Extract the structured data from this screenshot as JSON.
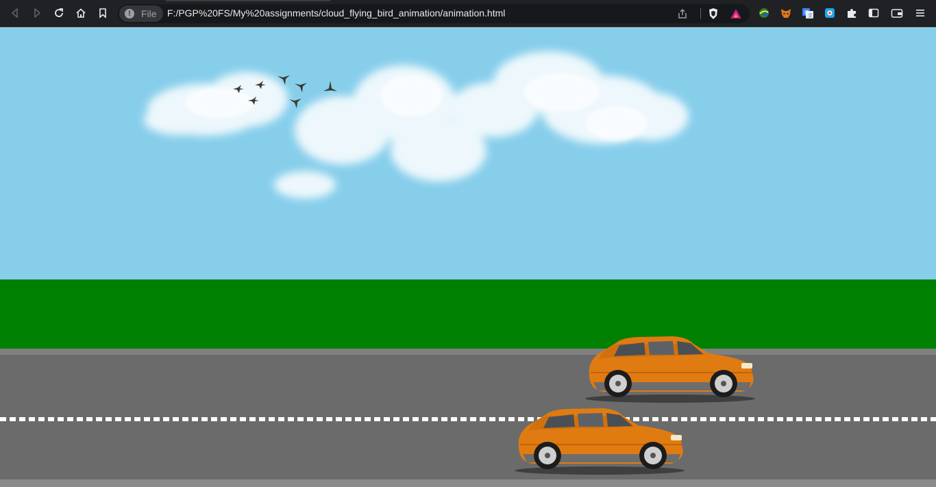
{
  "browser": {
    "site_chip_label": "File",
    "url": "F:/PGP%20FS/My%20assignments/cloud_flying_bird_animation/animation.html",
    "nav_icons": [
      "back-icon",
      "forward-icon",
      "reload-icon",
      "home-icon",
      "bookmark-icon"
    ],
    "extension_icons": [
      "brave-shield-icon",
      "brave-rewards-icon",
      "extension-globe-icon",
      "metamask-icon",
      "google-translate-icon",
      "extension-square-icon",
      "puzzle-icon",
      "sidebar-icon",
      "wallet-icon",
      "menu-icon"
    ]
  },
  "scene": {
    "sky_color": "#87ceeb",
    "grass_color": "#008000",
    "road_color": "#6b6b6b",
    "car_color": "#e07b12",
    "bird_count": 7,
    "car_count": 2
  }
}
